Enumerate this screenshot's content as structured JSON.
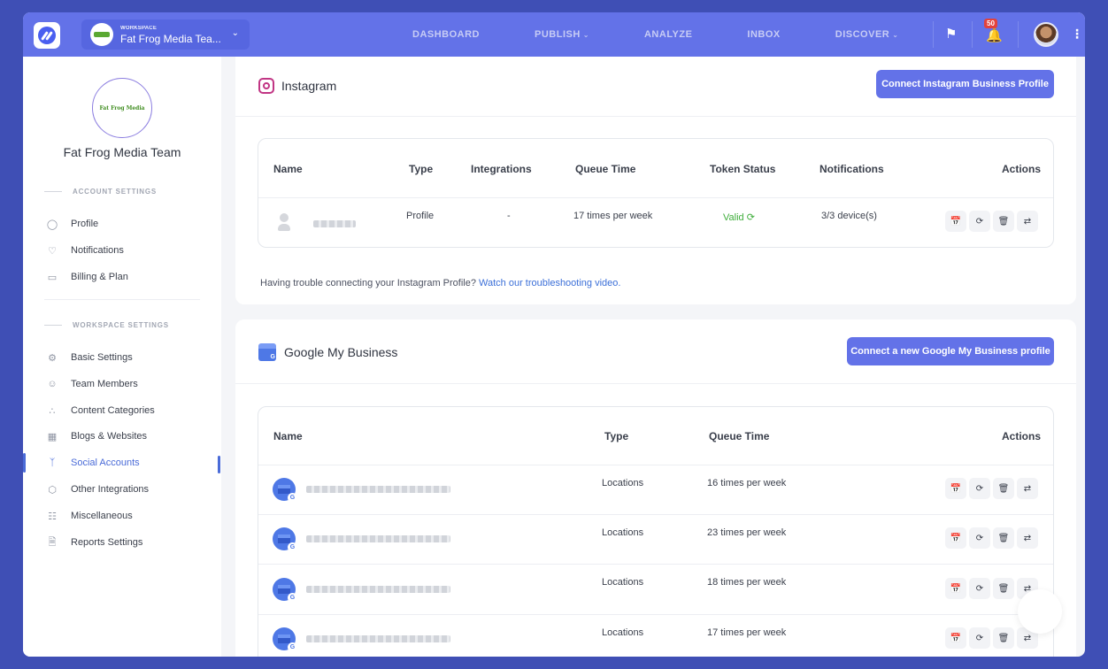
{
  "topbar": {
    "workspace_label": "WORKSPACE",
    "workspace_name": "Fat Frog Media Tea...",
    "nav": [
      {
        "label": "DASHBOARD"
      },
      {
        "label": "PUBLISH",
        "dropdown": true
      },
      {
        "label": "ANALYZE"
      },
      {
        "label": "INBOX"
      },
      {
        "label": "DISCOVER",
        "dropdown": true
      }
    ],
    "notification_count": "50"
  },
  "sidebar": {
    "org_logo_text": "Fat Frog Media",
    "org_name": "Fat Frog Media Team",
    "account_heading": "ACCOUNT SETTINGS",
    "account_items": [
      {
        "label": "Profile",
        "icon": "user-icon"
      },
      {
        "label": "Notifications",
        "icon": "bell-icon"
      },
      {
        "label": "Billing & Plan",
        "icon": "card-icon"
      }
    ],
    "workspace_heading": "WORKSPACE SETTINGS",
    "workspace_items": [
      {
        "label": "Basic Settings",
        "icon": "gear-icon"
      },
      {
        "label": "Team Members",
        "icon": "team-icon"
      },
      {
        "label": "Content Categories",
        "icon": "categories-icon"
      },
      {
        "label": "Blogs & Websites",
        "icon": "website-icon"
      },
      {
        "label": "Social Accounts",
        "icon": "branch-icon",
        "active": true
      },
      {
        "label": "Other Integrations",
        "icon": "hexagon-icon"
      },
      {
        "label": "Miscellaneous",
        "icon": "sliders-icon"
      },
      {
        "label": "Reports Settings",
        "icon": "document-icon"
      }
    ]
  },
  "instagram": {
    "title": "Instagram",
    "connect_button": "Connect Instagram Business Profile",
    "columns": [
      "Name",
      "Type",
      "Integrations",
      "Queue Time",
      "Token Status",
      "Notifications",
      "Actions"
    ],
    "rows": [
      {
        "type": "Profile",
        "integrations": "-",
        "queue_time": "17 times per week",
        "token_status": "Valid",
        "notifications": "3/3 device(s)"
      }
    ],
    "trouble_text": "Having trouble connecting your Instagram Profile?",
    "trouble_link": "Watch our troubleshooting video."
  },
  "gmb": {
    "title": "Google My Business",
    "connect_button": "Connect a new Google My Business profile",
    "columns": [
      "Name",
      "Type",
      "Queue Time",
      "Actions"
    ],
    "rows": [
      {
        "type": "Locations",
        "queue_time": "16 times per week"
      },
      {
        "type": "Locations",
        "queue_time": "23 times per week"
      },
      {
        "type": "Locations",
        "queue_time": "18 times per week"
      },
      {
        "type": "Locations",
        "queue_time": "17 times per week"
      }
    ]
  }
}
